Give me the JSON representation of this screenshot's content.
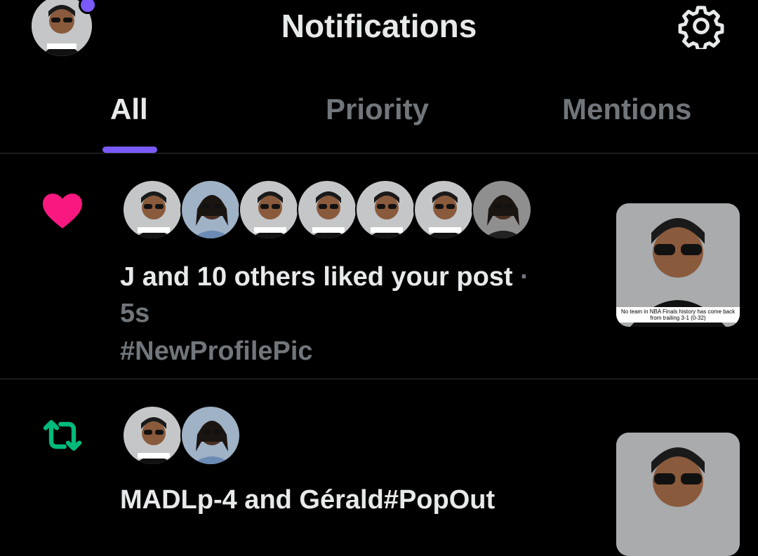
{
  "header": {
    "title": "Notifications"
  },
  "tabs": [
    {
      "label": "All"
    },
    {
      "label": "Priority"
    },
    {
      "label": "Mentions"
    }
  ],
  "notifications": [
    {
      "type": "like",
      "icon": "heart-icon",
      "text": "J and 10 others liked your post",
      "time": "5s",
      "post_text": "#NewProfilePic",
      "thumbnail_caption": "No team in NBA Finals history has come back from trailing 3-1 (0-32)"
    },
    {
      "type": "repost",
      "icon": "repost-icon",
      "text": "MADLp-4 and Gérald#PopOut"
    }
  ],
  "colors": {
    "accent": "#7a5af8",
    "like": "#f91880",
    "repost": "#00ba7c",
    "muted": "#71767b"
  }
}
